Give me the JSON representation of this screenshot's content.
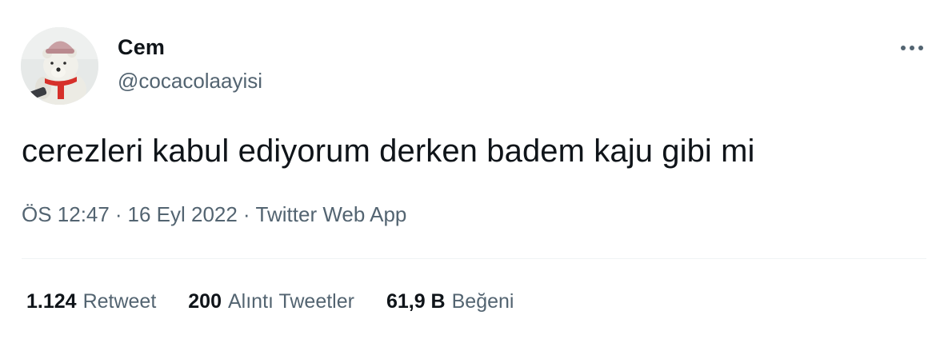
{
  "author": {
    "display_name": "Cem",
    "handle": "@cocacolaayisi"
  },
  "tweet": {
    "text": "cerezleri kabul ediyorum derken badem kaju gibi mi",
    "time": "ÖS 12:47",
    "date": "16 Eyl 2022",
    "source": "Twitter Web App",
    "separator": "·"
  },
  "stats": [
    {
      "count": "1.124",
      "label": "Retweet"
    },
    {
      "count": "200",
      "label": "Alıntı Tweetler"
    },
    {
      "count": "61,9 B",
      "label": "Beğeni"
    }
  ],
  "icons": {
    "more": "more-horizontal-icon",
    "avatar": "polar-bear-plush-avatar"
  },
  "colors": {
    "primary_text": "#0f1419",
    "secondary_text": "#536471",
    "divider": "#eff3f4"
  }
}
